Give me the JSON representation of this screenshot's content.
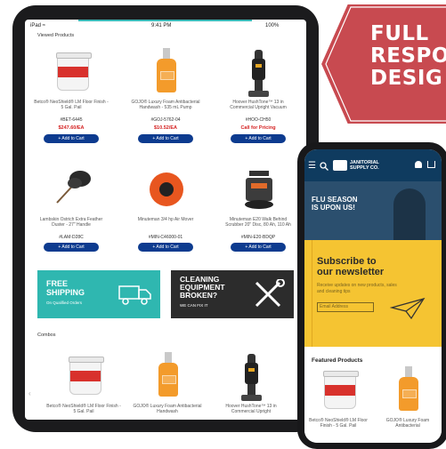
{
  "badge": {
    "line1": "FULL",
    "line2": "RESPO",
    "line3": "DESIG",
    "color": "#c84a50"
  },
  "tablet": {
    "status": {
      "left": "iPad ≈",
      "time": "9:41 PM",
      "battery": "100%"
    },
    "recent_label": "Viewed Products",
    "products": [
      {
        "name": "Betco® NeoShield® LM Floor Finish - 5 Gal. Pail",
        "sku": "#BET-6445",
        "price": "$247.60/EA",
        "button": "+ Add to Cart"
      },
      {
        "name": "GOJO® Luxury Foam Antibacterial Handwash - 535 mL Pump",
        "sku": "#GOJ-5762-04",
        "price": "$10.52/EA",
        "button": "+ Add to Cart"
      },
      {
        "name": "Hoover HushTone™ 13 in Commercial Upright Vacuum",
        "sku": "#HOO-CH50",
        "price": "Call for Pricing",
        "button": "+ Add to Cart"
      },
      {
        "name": "Lambskin Ostrich Extra Feather Duster - 27\" Handle",
        "sku": "#LAM-D28C",
        "price": "",
        "button": "+ Add to Cart"
      },
      {
        "name": "Minuteman 3/4 hp Air Mover",
        "sku": "#MIN-C46000-01",
        "price": "",
        "button": "+ Add to Cart"
      },
      {
        "name": "Minuteman E20 Walk Behind Scrubber 20\" Disc, 80 Ah, 110 Ah",
        "sku": "#MIN-E20-BDQP",
        "price": "",
        "button": "+ Add to Cart"
      }
    ],
    "banners": {
      "free_shipping_line1": "FREE",
      "free_shipping_line2": "SHIPPING",
      "free_shipping_sub": "On Qualified Orders",
      "cleaning_line1": "CLEANING",
      "cleaning_line2": "EQUIPMENT",
      "cleaning_line3": "BROKEN?",
      "cleaning_sub": "WE CAN FIX IT"
    },
    "combos_label": "Combos",
    "bottom_products": [
      {
        "name": "Betco® NeoShield® LM Floor Finish - 5 Gal. Pail"
      },
      {
        "name": "GOJO® Luxury Foam Antibacterial Handwash"
      },
      {
        "name": "Hoover HushTone™ 13 in Commercial Upright"
      }
    ]
  },
  "phone": {
    "brand_line1": "JANITORIAL",
    "brand_line2": "SUPPLY CO.",
    "hero_line1": "FLU SEASON",
    "hero_line2": "IS UPON US!",
    "news_title_line1": "Subscribe to",
    "news_title_line2": "our newsletter",
    "news_sub": "Receive updates on new products, sales and cleaning tips",
    "news_input_placeholder": "Email Address",
    "featured_label": "Featured Products",
    "featured": [
      {
        "name": "Betco® NeoShield® LM Floor Finish - 5 Gal. Pail"
      },
      {
        "name": "GOJO® Luxury Foam Antibacterial"
      }
    ]
  }
}
